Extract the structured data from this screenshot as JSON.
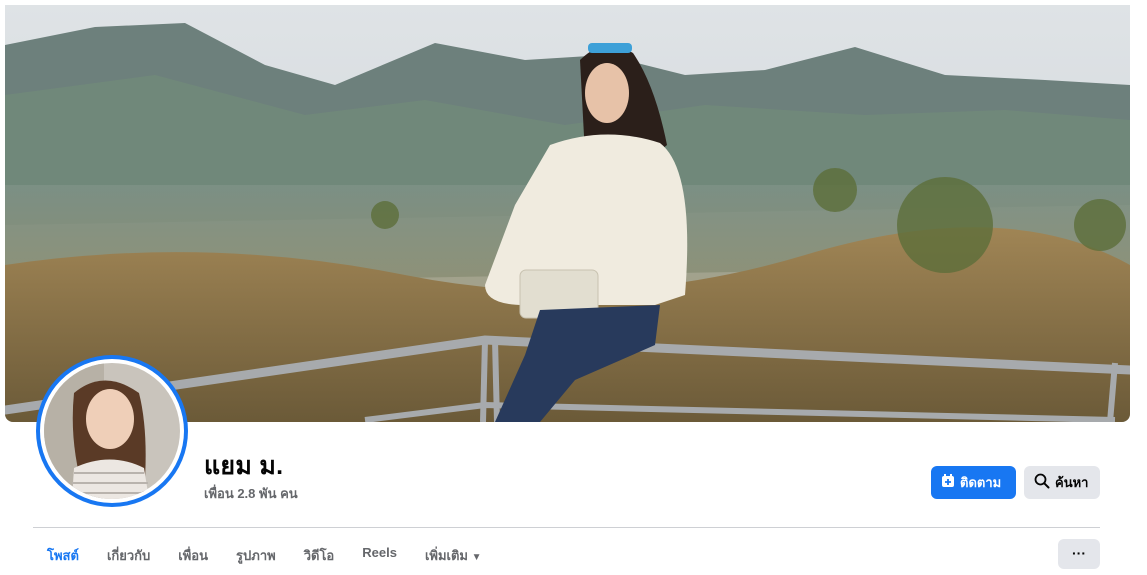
{
  "profile": {
    "name": "แยม ม.",
    "friends": "เพื่อน 2.8 พัน คน"
  },
  "actions": {
    "follow_label": "ติดตาม",
    "search_label": "ค้นหา"
  },
  "tabs": [
    {
      "label": "โพสต์",
      "active": true
    },
    {
      "label": "เกี่ยวกับ",
      "active": false
    },
    {
      "label": "เพื่อน",
      "active": false
    },
    {
      "label": "รูปภาพ",
      "active": false
    },
    {
      "label": "วิดีโอ",
      "active": false
    },
    {
      "label": "Reels",
      "active": false
    },
    {
      "label": "เพิ่มเติม",
      "active": false
    }
  ],
  "more_menu_icon": "ellipsis-icon",
  "colors": {
    "accent": "#1877f2",
    "secondary_button": "#e4e6eb",
    "muted_text": "#65676b"
  }
}
